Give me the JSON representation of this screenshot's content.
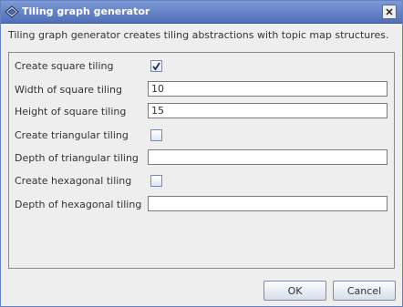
{
  "window": {
    "title": "Tiling graph generator",
    "app_icon": "topicmap-diamond-icon",
    "close_icon": "close-icon"
  },
  "description": "Tiling graph generator creates tiling abstractions with topic map structures.",
  "form": {
    "create_square": {
      "label": "Create square tiling",
      "checked": true
    },
    "square_width": {
      "label": "Width of square tiling",
      "value": "10"
    },
    "square_height": {
      "label": "Height of square tiling",
      "value": "15"
    },
    "create_triangular": {
      "label": "Create triangular tiling",
      "checked": false
    },
    "triangular_depth": {
      "label": "Depth of triangular tiling",
      "value": ""
    },
    "create_hexagonal": {
      "label": "Create hexagonal tiling",
      "checked": false
    },
    "hexagonal_depth": {
      "label": "Depth of hexagonal tiling",
      "value": ""
    }
  },
  "buttons": {
    "ok": "OK",
    "cancel": "Cancel"
  },
  "colors": {
    "titlebar": "#5a79c0",
    "accent_border": "#7a8aa8",
    "background": "#eeeeee"
  }
}
